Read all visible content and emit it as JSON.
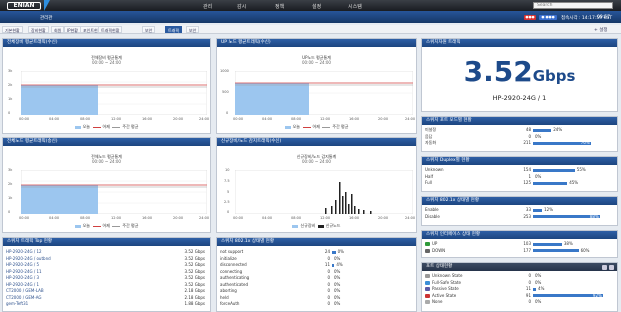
{
  "header": {
    "logo": "ENIAN",
    "nav": [
      "관리",
      "감시",
      "정책",
      "설정",
      "시스템"
    ],
    "search_placeholder": "Search",
    "subtitle": "관리관",
    "tag_red": "●●●",
    "tag_blue": "● ●●●",
    "clock": "접속시각 : 14:17:59 KST",
    "clock_right": "09:57"
  },
  "tabs": [
    "기본현황",
    "장비현황",
    "회원",
    "IP현황",
    "포인트현황",
    "트래픽현황",
    "보안",
    "트래픽",
    "보안"
  ],
  "settings_label": "+ 설정",
  "panels": {
    "p1": "전체장비 평균트래픽(수신)",
    "p2": "UP 노드 평균트래픽(수신)",
    "p3": "전체노드 평균트래픽(송신)",
    "p4": "신규장비/노드 감지트래픽(수신)",
    "p5": "스위치 트래픽 Top 현황",
    "p6": "스위치 802.1x 상태별 현황",
    "p7": "스위치자원 트래픽",
    "p8": "스위치 포트 모드별 현황",
    "p9": "스위치 Duplex별 현황",
    "p10": "스위치 802.1x 상태별 현황",
    "p11": "스위치 인터페이스 상태 현황",
    "p12": "포트 상태현황"
  },
  "charts": {
    "c1": {
      "title": "전체장비 평균통계",
      "range": "00:00 ~ 24:00",
      "y_ticks": [
        "3k",
        "2k",
        "1k",
        "0"
      ]
    },
    "c2": {
      "title": "UP노드 평균통계",
      "range": "00:00 ~ 24:00",
      "y_ticks": [
        "1000",
        "500",
        "0"
      ]
    },
    "c3": {
      "title": "전체노드 평균통계",
      "range": "00:00 ~ 24:00",
      "y_ticks": [
        "3k",
        "2k",
        "1k",
        "0"
      ]
    },
    "c4": {
      "title": "신규장비/노드 감지통계",
      "range": "00:00 ~ 24:00",
      "y_ticks": [
        "10",
        "7.5",
        "5",
        "2.5",
        "0"
      ]
    },
    "x_ticks": [
      "00:00",
      "04:00",
      "08:00",
      "12:00",
      "16:00",
      "20:00",
      "24:00"
    ]
  },
  "legend": {
    "today": "오늘",
    "yesterday": "어제",
    "week": "주간 평균",
    "new_device": "신규장비",
    "new_node": "신규노드"
  },
  "big_stat": {
    "value": "3.52",
    "unit": "Gbps",
    "device": "HP-2920-24G / 1"
  },
  "top_traffic": [
    {
      "name": "HP-2920-24G / 12",
      "value": "3.52 Gbps"
    },
    {
      "name": "HP-2920-24G / outbnd",
      "value": "3.52 Gbps"
    },
    {
      "name": "HP-2920-24G / 5",
      "value": "3.52 Gbps"
    },
    {
      "name": "HP-2920-24G / 11",
      "value": "3.52 Gbps"
    },
    {
      "name": "HP-2920-24G / 3",
      "value": "3.52 Gbps"
    },
    {
      "name": "HP-2920-24G / 1",
      "value": "3.52 Gbps"
    },
    {
      "name": "CT2000 / GEM-LAB",
      "value": "2.18 Gbps"
    },
    {
      "name": "CT2000 / GEM-AG",
      "value": "2.18 Gbps"
    },
    {
      "name": "gem-Teft31",
      "value": "1.88 Gbps"
    }
  ],
  "dot1x_states": [
    {
      "name": "not support",
      "count": "24",
      "pct": "0%",
      "fill": 0.06
    },
    {
      "name": "initialize",
      "count": "0",
      "pct": "0%",
      "fill": 0
    },
    {
      "name": "disconnected",
      "count": "11",
      "pct": "4%",
      "fill": 0.04
    },
    {
      "name": "connecting",
      "count": "0",
      "pct": "0%",
      "fill": 0
    },
    {
      "name": "authenticating",
      "count": "0",
      "pct": "0%",
      "fill": 0
    },
    {
      "name": "authenticated",
      "count": "0",
      "pct": "0%",
      "fill": 0
    },
    {
      "name": "aborting",
      "count": "0",
      "pct": "0%",
      "fill": 0
    },
    {
      "name": "held",
      "count": "0",
      "pct": "0%",
      "fill": 0
    },
    {
      "name": "forceAuth",
      "count": "0",
      "pct": "0%",
      "fill": 0
    }
  ],
  "port_mode": [
    {
      "name": "미설정",
      "count": "48",
      "pct": "24%",
      "fill": 0.24
    },
    {
      "name": "음답",
      "count": "0",
      "pct": "0%",
      "fill": 0
    },
    {
      "name": "자동화",
      "count": "211",
      "pct": "76%",
      "fill": 0.76
    }
  ],
  "duplex": [
    {
      "name": "Unknown",
      "count": "154",
      "pct": "55%",
      "fill": 0.55
    },
    {
      "name": "Half",
      "count": "1",
      "pct": "0%",
      "fill": 0
    },
    {
      "name": "Full",
      "count": "125",
      "pct": "45%",
      "fill": 0.45
    }
  ],
  "dot1x_sw": [
    {
      "name": "Enable",
      "count": "33",
      "pct": "12%",
      "fill": 0.12
    },
    {
      "name": "Disable",
      "count": "253",
      "pct": "88%",
      "fill": 0.88
    }
  ],
  "iface": [
    {
      "name": "UP",
      "count": "103",
      "pct": "38%",
      "fill": 0.38,
      "color": "#2f9a3a"
    },
    {
      "name": "DOWN",
      "count": "177",
      "pct": "60%",
      "fill": 0.6,
      "color": "#666666"
    }
  ],
  "port_state": [
    {
      "name": "Unknown State",
      "count": "0",
      "pct": "0%",
      "fill": 0,
      "color": "#999999"
    },
    {
      "name": "Full-Safe State",
      "count": "0",
      "pct": "0%",
      "fill": 0,
      "color": "#3c8fd8"
    },
    {
      "name": "Passive State",
      "count": "11",
      "pct": "4%",
      "fill": 0.04,
      "color": "#5a5aa8"
    },
    {
      "name": "Active State",
      "count": "91",
      "pct": "92%",
      "fill": 0.92,
      "color": "#c33"
    },
    {
      "name": "None",
      "count": "0",
      "pct": "0%",
      "fill": 0,
      "color": "#aaaaaa"
    }
  ],
  "colors": {
    "today": "#8fbfee",
    "yesterday": "#d04040",
    "week": "#999999",
    "accent": "#1d4a8a"
  }
}
